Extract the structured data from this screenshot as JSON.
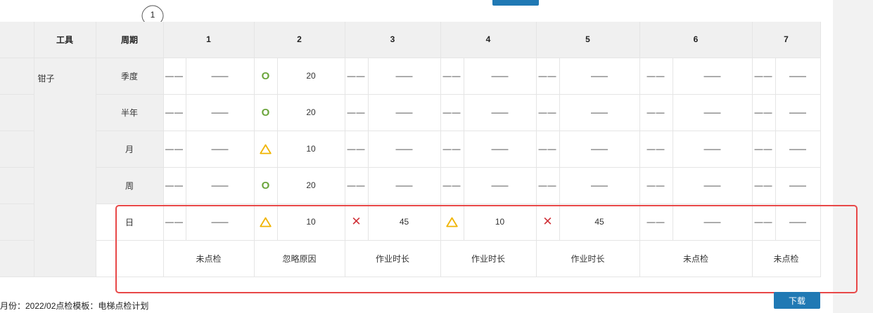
{
  "step_marker": "1",
  "header": {
    "tool": "工具",
    "period": "周期",
    "days": [
      "1",
      "2",
      "3",
      "4",
      "5",
      "6",
      "7"
    ]
  },
  "tool_name": "钳子",
  "dash": "——",
  "rows": [
    {
      "period": "季度",
      "v1": "——",
      "v2": "20",
      "v3": "——",
      "v4": "——",
      "v5": "——",
      "v6": "——",
      "v7": "——"
    },
    {
      "period": "半年",
      "v1": "——",
      "v2": "20",
      "v3": "——",
      "v4": "——",
      "v5": "——",
      "v6": "——",
      "v7": "——"
    },
    {
      "period": "月",
      "v1": "——",
      "v2": "10",
      "v3": "——",
      "v4": "——",
      "v5": "——",
      "v6": "——",
      "v7": "——"
    },
    {
      "period": "周",
      "v1": "——",
      "v2": "20",
      "v3": "——",
      "v4": "——",
      "v5": "——",
      "v6": "——",
      "v7": "——"
    },
    {
      "period": "日",
      "v1": "——",
      "v2": "10",
      "v3": "45",
      "v4": "10",
      "v5": "45",
      "v6": "——",
      "v7": "——"
    }
  ],
  "markers": {
    "circle": "O",
    "cross": "✕"
  },
  "status_row": [
    "未点检",
    "忽略原因",
    "作业时长",
    "作业时长",
    "作业时长",
    "未点检",
    "未点检"
  ],
  "footer": "月份：2022/02点检模板：电梯点检计划",
  "download_label": "下载",
  "colors": {
    "accent": "#2079b4",
    "link": "#2b8fd6",
    "ok": "#6aa43a",
    "warn": "#f0b400",
    "fail": "#d0333a",
    "highlight": "#e84848"
  }
}
